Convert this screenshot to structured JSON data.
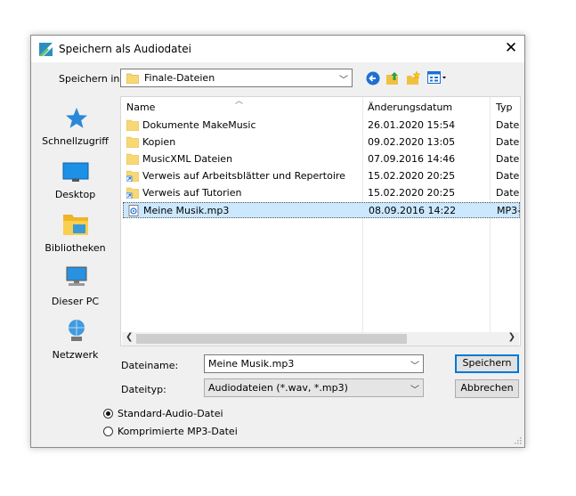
{
  "window": {
    "title": "Speichern als Audiodatei",
    "close_glyph": "✕"
  },
  "location": {
    "label": "Speichern in:",
    "value": "Finale-Dateien"
  },
  "places": [
    {
      "label": "Schnellzugriff",
      "icon": "star-icon"
    },
    {
      "label": "Desktop",
      "icon": "desktop-icon"
    },
    {
      "label": "Bibliotheken",
      "icon": "libraries-icon"
    },
    {
      "label": "Dieser PC",
      "icon": "computer-icon"
    },
    {
      "label": "Netzwerk",
      "icon": "network-icon"
    }
  ],
  "columns": {
    "name": "Name",
    "date": "Änderungsdatum",
    "type": "Typ"
  },
  "files": [
    {
      "name": "Dokumente MakeMusic",
      "date": "26.01.2020 15:54",
      "type": "Datei",
      "kind": "folder"
    },
    {
      "name": "Kopien",
      "date": "09.02.2020 13:05",
      "type": "Datei",
      "kind": "folder"
    },
    {
      "name": "MusicXML Dateien",
      "date": "07.09.2016 14:46",
      "type": "Datei",
      "kind": "folder"
    },
    {
      "name": "Verweis auf Arbeitsblätter und Repertoire",
      "date": "15.02.2020 20:25",
      "type": "Datei",
      "kind": "shortcut"
    },
    {
      "name": "Verweis auf Tutorien",
      "date": "15.02.2020 20:25",
      "type": "Datei",
      "kind": "shortcut"
    },
    {
      "name": "Meine Musik.mp3",
      "date": "08.09.2016 14:22",
      "type": "MP3-",
      "kind": "audio",
      "selected": true
    }
  ],
  "filename": {
    "label": "Dateiname:",
    "value": "Meine Musik.mp3"
  },
  "filetype": {
    "label": "Dateityp:",
    "value": "Audiodateien (*.wav, *.mp3)"
  },
  "buttons": {
    "save": "Speichern",
    "cancel": "Abbrechen"
  },
  "options": [
    {
      "label": "Standard-Audio-Datei",
      "checked": true
    },
    {
      "label": "Komprimierte MP3-Datei",
      "checked": false
    }
  ],
  "colors": {
    "accent": "#0078d7",
    "selection": "#cce8ff",
    "folder": "#f8d775"
  }
}
